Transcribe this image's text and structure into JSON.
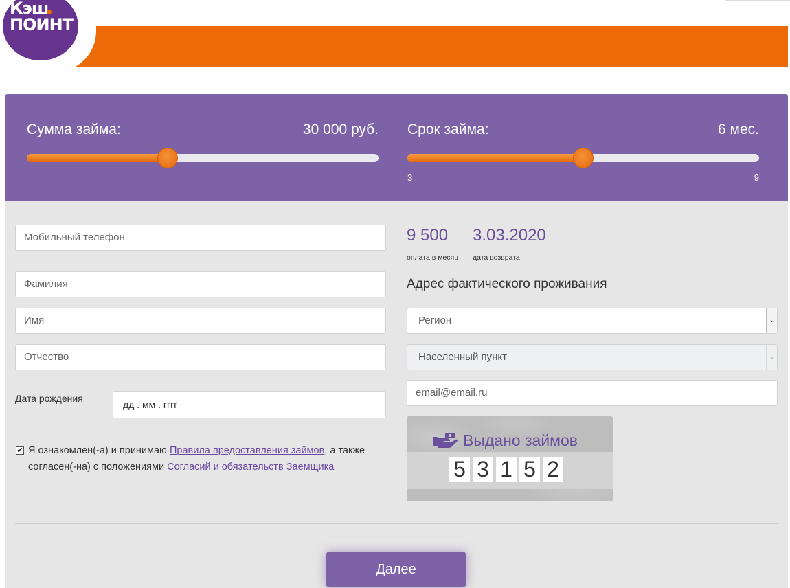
{
  "brand": {
    "logo_line1": "Кэш",
    "logo_line2": "поинт",
    "purple": "#7e62a8",
    "orange": "#ec6a08"
  },
  "sliders": {
    "amount": {
      "title": "Сумма займа:",
      "value_text": "30 000 руб.",
      "level_fraction": 0.4
    },
    "term": {
      "title": "Срок займа:",
      "value_text": "6 мес.",
      "min_label": "3",
      "max_label": "9",
      "value": 6,
      "min": 3,
      "max": 9
    }
  },
  "form": {
    "phone_placeholder": "Мобильный телефон",
    "lastname_placeholder": "Фамилия",
    "firstname_placeholder": "Имя",
    "patronymic_placeholder": "Отчество",
    "dob_label": "Дата рождения",
    "dob_placeholder": "дд . мм . гггг",
    "agree_part1": "Я ознакомлен(-а) и принимаю ",
    "agree_link1": "Правила предоставления займов",
    "agree_part2": ", а также согласен(-на) с положениями ",
    "agree_link2": "Согласий и обязательств Заемщика",
    "agree_checked_mark": "✔"
  },
  "summary": {
    "monthly_payment": "9 500",
    "monthly_payment_label": "оплата в месяц",
    "return_date": "3.03.2020",
    "return_date_label": "дата возврата"
  },
  "address": {
    "title": "Адрес фактического проживания",
    "region_select": "Регион",
    "locality_select": "Населенный пункт",
    "email_placeholder": "email@email.ru",
    "select_arrow": "⌄"
  },
  "counter": {
    "title": "Выдано займов",
    "digits": [
      "5",
      "3",
      "1",
      "5",
      "2"
    ]
  },
  "actions": {
    "next_label": "Далее"
  }
}
